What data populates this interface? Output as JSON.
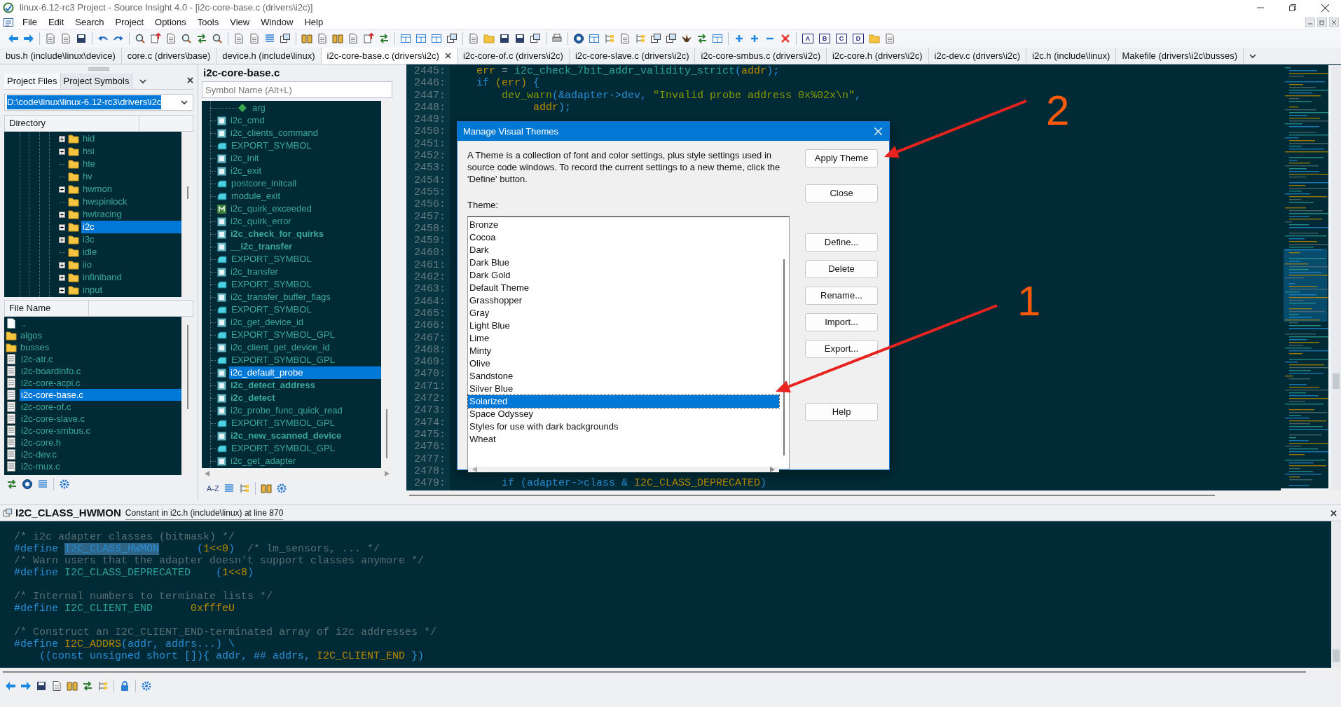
{
  "window": {
    "title": "linux-6.12-rc3 Project - Source Insight 4.0 - [i2c-core-base.c (drivers\\i2c)]"
  },
  "menu": [
    "File",
    "Edit",
    "Search",
    "Project",
    "Options",
    "Tools",
    "View",
    "Window",
    "Help"
  ],
  "bookmark_buttons": [
    "A",
    "B",
    "C",
    "D"
  ],
  "tabs": [
    {
      "label": "bus.h (include\\linux\\device)",
      "selected": false
    },
    {
      "label": "core.c (drivers\\base)",
      "selected": false
    },
    {
      "label": "device.h (include\\linux)",
      "selected": false
    },
    {
      "label": "i2c-core-base.c (drivers\\i2c)",
      "selected": true
    },
    {
      "label": "i2c-core-of.c (drivers\\i2c)",
      "selected": false
    },
    {
      "label": "i2c-core-slave.c (drivers\\i2c)",
      "selected": false
    },
    {
      "label": "i2c-core-smbus.c (drivers\\i2c)",
      "selected": false
    },
    {
      "label": "i2c-core.h (drivers\\i2c)",
      "selected": false
    },
    {
      "label": "i2c-dev.c (drivers\\i2c)",
      "selected": false
    },
    {
      "label": "i2c.h (include\\linux)",
      "selected": false
    },
    {
      "label": "Makefile (drivers\\i2c\\busses)",
      "selected": false
    }
  ],
  "project_panel": {
    "tabs": [
      {
        "label": "Project Files",
        "selected": true
      },
      {
        "label": "Project Symbols",
        "selected": false
      }
    ],
    "path": "D:\\code\\linux\\linux-6.12-rc3\\drivers\\i2c",
    "directory_header": "Directory",
    "directories": [
      {
        "name": "hid",
        "has_children": true,
        "selected": false
      },
      {
        "name": "hsi",
        "has_children": true,
        "selected": false
      },
      {
        "name": "hte",
        "has_children": false,
        "selected": false
      },
      {
        "name": "hv",
        "has_children": false,
        "selected": false
      },
      {
        "name": "hwmon",
        "has_children": true,
        "selected": false
      },
      {
        "name": "hwspinlock",
        "has_children": false,
        "selected": false
      },
      {
        "name": "hwtracing",
        "has_children": true,
        "selected": false
      },
      {
        "name": "i2c",
        "has_children": true,
        "selected": true
      },
      {
        "name": "i3c",
        "has_children": true,
        "selected": false
      },
      {
        "name": "idle",
        "has_children": false,
        "selected": false
      },
      {
        "name": "iio",
        "has_children": true,
        "selected": false
      },
      {
        "name": "infiniband",
        "has_children": true,
        "selected": false
      },
      {
        "name": "input",
        "has_children": true,
        "selected": false
      }
    ],
    "file_header": "File Name",
    "files": [
      {
        "name": "..",
        "kind": "parent",
        "selected": false
      },
      {
        "name": "algos",
        "kind": "folder",
        "selected": false
      },
      {
        "name": "busses",
        "kind": "folder",
        "selected": false
      },
      {
        "name": "i2c-atr.c",
        "kind": "file",
        "selected": false
      },
      {
        "name": "i2c-boardinfo.c",
        "kind": "file",
        "selected": false
      },
      {
        "name": "i2c-core-acpi.c",
        "kind": "file",
        "selected": false
      },
      {
        "name": "i2c-core-base.c",
        "kind": "file",
        "selected": true
      },
      {
        "name": "i2c-core-of.c",
        "kind": "file",
        "selected": false
      },
      {
        "name": "i2c-core-slave.c",
        "kind": "file",
        "selected": false
      },
      {
        "name": "i2c-core-smbus.c",
        "kind": "file",
        "selected": false
      },
      {
        "name": "i2c-core.h",
        "kind": "file",
        "selected": false
      },
      {
        "name": "i2c-dev.c",
        "kind": "file",
        "selected": false
      },
      {
        "name": "i2c-mux.c",
        "kind": "file",
        "selected": false
      }
    ]
  },
  "symbol_panel": {
    "title": "i2c-core-base.c",
    "sort_label": "A-Z",
    "search": {
      "placeholder": "Symbol Name (Alt+L)"
    },
    "symbols": [
      {
        "name": "arg",
        "kind": "param",
        "bold": false,
        "selected": false
      },
      {
        "name": "i2c_cmd",
        "kind": "function",
        "bold": false,
        "selected": false
      },
      {
        "name": "i2c_clients_command",
        "kind": "function",
        "bold": false,
        "selected": false
      },
      {
        "name": "EXPORT_SYMBOL",
        "kind": "export",
        "bold": false,
        "selected": false
      },
      {
        "name": "i2c_init",
        "kind": "function",
        "bold": false,
        "selected": false
      },
      {
        "name": "i2c_exit",
        "kind": "function",
        "bold": false,
        "selected": false
      },
      {
        "name": "postcore_initcall",
        "kind": "export",
        "bold": false,
        "selected": false
      },
      {
        "name": "module_exit",
        "kind": "export",
        "bold": false,
        "selected": false
      },
      {
        "name": "i2c_quirk_exceeded",
        "kind": "macro",
        "bold": false,
        "selected": false
      },
      {
        "name": "i2c_quirk_error",
        "kind": "function",
        "bold": false,
        "selected": false
      },
      {
        "name": "i2c_check_for_quirks",
        "kind": "function",
        "bold": true,
        "selected": false
      },
      {
        "name": "__i2c_transfer",
        "kind": "function",
        "bold": true,
        "selected": false
      },
      {
        "name": "EXPORT_SYMBOL",
        "kind": "export",
        "bold": false,
        "selected": false
      },
      {
        "name": "i2c_transfer",
        "kind": "function",
        "bold": false,
        "selected": false
      },
      {
        "name": "EXPORT_SYMBOL",
        "kind": "export",
        "bold": false,
        "selected": false
      },
      {
        "name": "i2c_transfer_buffer_flags",
        "kind": "function",
        "bold": false,
        "selected": false
      },
      {
        "name": "EXPORT_SYMBOL",
        "kind": "export",
        "bold": false,
        "selected": false
      },
      {
        "name": "i2c_get_device_id",
        "kind": "function",
        "bold": false,
        "selected": false
      },
      {
        "name": "EXPORT_SYMBOL_GPL",
        "kind": "export",
        "bold": false,
        "selected": false
      },
      {
        "name": "i2c_client_get_device_id",
        "kind": "function",
        "bold": false,
        "selected": false
      },
      {
        "name": "EXPORT_SYMBOL_GPL",
        "kind": "export",
        "bold": false,
        "selected": false
      },
      {
        "name": "i2c_default_probe",
        "kind": "function",
        "bold": false,
        "selected": true
      },
      {
        "name": "i2c_detect_address",
        "kind": "function",
        "bold": true,
        "selected": false
      },
      {
        "name": "i2c_detect",
        "kind": "function",
        "bold": true,
        "selected": false
      },
      {
        "name": "i2c_probe_func_quick_read",
        "kind": "function",
        "bold": false,
        "selected": false
      },
      {
        "name": "EXPORT_SYMBOL_GPL",
        "kind": "export",
        "bold": false,
        "selected": false
      },
      {
        "name": "i2c_new_scanned_device",
        "kind": "function",
        "bold": true,
        "selected": false
      },
      {
        "name": "EXPORT_SYMBOL_GPL",
        "kind": "export",
        "bold": false,
        "selected": false
      },
      {
        "name": "i2c_get_adapter",
        "kind": "function",
        "bold": false,
        "selected": false
      }
    ]
  },
  "editor": {
    "lines": [
      {
        "number": "2445:",
        "tokens": [
          {
            "text": "    err",
            "kind": "var"
          },
          {
            "text": " = ",
            "kind": "plain"
          },
          {
            "text": "i2c_check_7bit_addr_validity_strict",
            "kind": "func"
          },
          {
            "text": "(",
            "kind": "punc"
          },
          {
            "text": "addr",
            "kind": "var"
          },
          {
            "text": ");",
            "kind": "punc"
          }
        ]
      },
      {
        "number": "2446:",
        "tokens": [
          {
            "text": "    if",
            "kind": "kw"
          },
          {
            "text": " (err)",
            "kind": "var"
          },
          {
            "text": " {",
            "kind": "punc"
          }
        ]
      },
      {
        "number": "2447:",
        "tokens": [
          {
            "text": "        dev_warn",
            "kind": "call"
          },
          {
            "text": "(&adapter->dev, ",
            "kind": "punc"
          },
          {
            "text": "\"Invalid probe address 0x%02x\\n\"",
            "kind": "str"
          },
          {
            "text": ",",
            "kind": "punc"
          }
        ]
      },
      {
        "number": "2448:",
        "tokens": [
          {
            "text": "             addr",
            "kind": "var"
          },
          {
            "text": ");",
            "kind": "punc"
          }
        ]
      },
      {
        "number": "2449:"
      },
      {
        "number": "2450:"
      },
      {
        "number": "2451:"
      },
      {
        "number": "2452:"
      },
      {
        "number": "2453:"
      },
      {
        "number": "2454:"
      },
      {
        "number": "2455:"
      },
      {
        "number": "2456:"
      },
      {
        "number": "2457:"
      },
      {
        "number": "2458:"
      },
      {
        "number": "2459:"
      },
      {
        "number": "2460:"
      },
      {
        "number": "2461:"
      },
      {
        "number": "2462:"
      },
      {
        "number": "2463:"
      },
      {
        "number": "2464:"
      },
      {
        "number": "2465:"
      },
      {
        "number": "2466:"
      },
      {
        "number": "2467:"
      },
      {
        "number": "2468:"
      },
      {
        "number": "2469:"
      },
      {
        "number": "2470:"
      },
      {
        "number": "2471:"
      },
      {
        "number": "2472:"
      },
      {
        "number": "2473:"
      },
      {
        "number": "2474:"
      },
      {
        "number": "2475:"
      },
      {
        "number": "2476:"
      },
      {
        "number": "2477:"
      },
      {
        "number": "2478:"
      },
      {
        "number": "2479:",
        "tokens": [
          {
            "text": "        if",
            "kind": "kw"
          },
          {
            "text": " (adapter->class & ",
            "kind": "punc"
          },
          {
            "text": "I2C_CLASS_DEPRECATED",
            "kind": "var"
          },
          {
            "text": ")",
            "kind": "punc"
          }
        ]
      }
    ]
  },
  "dialog": {
    "title": "Manage Visual Themes",
    "description": "A Theme is a collection of font and color settings, plus style settings used in source code windows. To record the current settings to a new theme, click the 'Define' button.",
    "list_label": "Theme:",
    "themes": [
      {
        "name": "Bronze",
        "selected": false
      },
      {
        "name": "Cocoa",
        "selected": false
      },
      {
        "name": "Dark",
        "selected": false
      },
      {
        "name": "Dark Blue",
        "selected": false
      },
      {
        "name": "Dark Gold",
        "selected": false
      },
      {
        "name": "Default Theme",
        "selected": false
      },
      {
        "name": "Grasshopper",
        "selected": false
      },
      {
        "name": "Gray",
        "selected": false
      },
      {
        "name": "Light Blue",
        "selected": false
      },
      {
        "name": "Lime",
        "selected": false
      },
      {
        "name": "Minty",
        "selected": false
      },
      {
        "name": "Olive",
        "selected": false
      },
      {
        "name": "Sandstone",
        "selected": false
      },
      {
        "name": "Silver Blue",
        "selected": false
      },
      {
        "name": "Solarized",
        "selected": true
      },
      {
        "name": "Space Odyssey",
        "selected": false
      },
      {
        "name": "Styles for use with dark backgrounds",
        "selected": false
      },
      {
        "name": "Wheat",
        "selected": false
      }
    ],
    "buttons": [
      "Apply Theme",
      "Close",
      "Define...",
      "Delete",
      "Rename...",
      "Import...",
      "Export...",
      "Help"
    ]
  },
  "context": {
    "symbol": "I2C_CLASS_HWMON",
    "description": "Constant in i2c.h (include\\linux) at line 870",
    "lines": [
      {
        "kind": "code",
        "tokens": [
          {
            "text": "/* i2c adapter classes (bitmask) */",
            "kind": "comment"
          }
        ]
      },
      {
        "kind": "code",
        "tokens": [
          {
            "text": "#define ",
            "kind": "kw"
          },
          {
            "text": "I2C_CLASS_HWMON",
            "kind": "hl"
          },
          {
            "text": "      (",
            "kind": "punc"
          },
          {
            "text": "1<<0",
            "kind": "num"
          },
          {
            "text": ")",
            "kind": "punc"
          },
          {
            "text": "  /* lm_sensors, ... */",
            "kind": "comment"
          }
        ]
      },
      {
        "kind": "code",
        "tokens": [
          {
            "text": "/* Warn users that the adapter doesn't support classes anymore */",
            "kind": "comment"
          }
        ]
      },
      {
        "kind": "code",
        "tokens": [
          {
            "text": "#define ",
            "kind": "kw"
          },
          {
            "text": "I2C_CLASS_DEPRECATED",
            "kind": "macro"
          },
          {
            "text": "    (",
            "kind": "punc"
          },
          {
            "text": "1<<8",
            "kind": "num"
          },
          {
            "text": ")",
            "kind": "punc"
          }
        ]
      },
      {
        "kind": "blank"
      },
      {
        "kind": "code",
        "tokens": [
          {
            "text": "/* Internal numbers to terminate lists */",
            "kind": "comment"
          }
        ]
      },
      {
        "kind": "code",
        "tokens": [
          {
            "text": "#define ",
            "kind": "kw"
          },
          {
            "text": "I2C_CLIENT_END",
            "kind": "macro"
          },
          {
            "text": "      0xfffeU",
            "kind": "num"
          }
        ]
      },
      {
        "kind": "blank"
      },
      {
        "kind": "code",
        "tokens": [
          {
            "text": "/* Construct an I2C_CLIENT_END-terminated array of i2c addresses */",
            "kind": "comment"
          }
        ]
      },
      {
        "kind": "code",
        "tokens": [
          {
            "text": "#define ",
            "kind": "kw"
          },
          {
            "text": "I2C_ADDRS",
            "kind": "var"
          },
          {
            "text": "(addr, addrs...) \\",
            "kind": "punc"
          }
        ]
      },
      {
        "kind": "code",
        "tokens": [
          {
            "text": "    ((const unsigned short []){ addr, ## addrs, ",
            "kind": "punc"
          },
          {
            "text": "I2C_CLIENT_END",
            "kind": "var"
          },
          {
            "text": " })",
            "kind": "punc"
          }
        ]
      }
    ]
  },
  "annotations": [
    {
      "label": "2"
    },
    {
      "label": "1"
    }
  ]
}
